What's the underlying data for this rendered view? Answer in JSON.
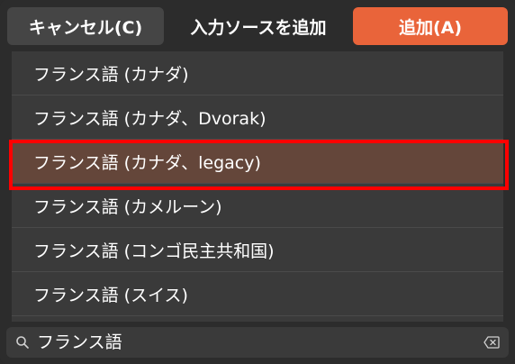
{
  "header": {
    "cancel_label": "キャンセル(C)",
    "title": "入力ソースを追加",
    "add_label": "追加(A)"
  },
  "list": {
    "items": [
      {
        "label": "フランス語 (カナダ)",
        "selected": false
      },
      {
        "label": "フランス語 (カナダ、Dvorak)",
        "selected": false
      },
      {
        "label": "フランス語 (カナダ、legacy)",
        "selected": true
      },
      {
        "label": "フランス語 (カメルーン)",
        "selected": false
      },
      {
        "label": "フランス語 (コンゴ民主共和国)",
        "selected": false
      },
      {
        "label": "フランス語 (スイス)",
        "selected": false
      }
    ]
  },
  "search": {
    "value": "フランス語",
    "icon": "search-icon",
    "clear_icon": "backspace-clear-icon"
  },
  "colors": {
    "accent": "#e9643a",
    "selected_row": "#64463a",
    "highlight_box": "#ff0000"
  }
}
